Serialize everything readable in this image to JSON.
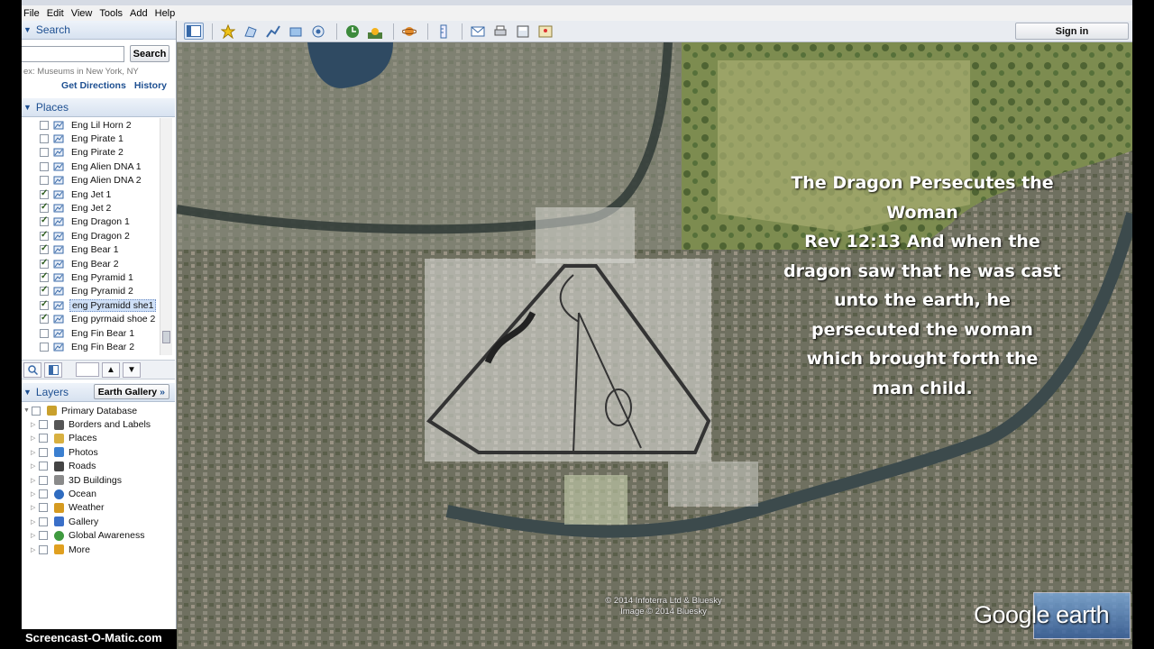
{
  "menu": [
    "File",
    "Edit",
    "View",
    "Tools",
    "Add",
    "Help"
  ],
  "toolbar": {
    "sign_in": "Sign in"
  },
  "search": {
    "title": "Search",
    "button": "Search",
    "hint": "ex: Museums in New York, NY",
    "get_directions": "Get Directions",
    "history": "History"
  },
  "places": {
    "title": "Places",
    "items": [
      {
        "label": "Eng Lil Horn 2",
        "checked": false
      },
      {
        "label": "Eng Pirate 1",
        "checked": false
      },
      {
        "label": "Eng Pirate 2",
        "checked": false
      },
      {
        "label": "Eng Alien DNA 1",
        "checked": false
      },
      {
        "label": "Eng Alien DNA 2",
        "checked": false
      },
      {
        "label": "Eng Jet 1",
        "checked": true
      },
      {
        "label": "Eng Jet 2",
        "checked": true
      },
      {
        "label": "Eng Dragon 1",
        "checked": true
      },
      {
        "label": "Eng Dragon 2",
        "checked": true
      },
      {
        "label": "Eng Bear 1",
        "checked": true
      },
      {
        "label": "Eng Bear 2",
        "checked": true
      },
      {
        "label": "Eng Pyramid 1",
        "checked": true
      },
      {
        "label": "Eng Pyramid 2",
        "checked": true
      },
      {
        "label": "eng Pyramidd she1",
        "checked": true,
        "selected": true
      },
      {
        "label": "Eng pyrmaid shoe 2",
        "checked": true
      },
      {
        "label": "Eng Fin Bear 1",
        "checked": false
      },
      {
        "label": "Eng Fin Bear 2",
        "checked": false
      }
    ]
  },
  "layers": {
    "title": "Layers",
    "earth_gallery": "Earth Gallery",
    "earth_gallery_arrow": "»",
    "items": [
      {
        "label": "Primary Database",
        "icon": "database-icon",
        "color": "#c9a02c"
      },
      {
        "label": "Borders and Labels",
        "icon": "flag-icon",
        "color": "#555555"
      },
      {
        "label": "Places",
        "icon": "places-icon",
        "color": "#d8b040"
      },
      {
        "label": "Photos",
        "icon": "photo-icon",
        "color": "#3b7fd0"
      },
      {
        "label": "Roads",
        "icon": "road-icon",
        "color": "#444444"
      },
      {
        "label": "3D Buildings",
        "icon": "building-icon",
        "color": "#8a8a8a"
      },
      {
        "label": "Ocean",
        "icon": "ocean-icon",
        "color": "#2f6cc0"
      },
      {
        "label": "Weather",
        "icon": "weather-icon",
        "color": "#d59a20"
      },
      {
        "label": "Gallery",
        "icon": "gallery-icon",
        "color": "#3a6fc8"
      },
      {
        "label": "Global Awareness",
        "icon": "globe-icon",
        "color": "#3f9a3f"
      },
      {
        "label": "More",
        "icon": "more-icon",
        "color": "#e0a020"
      }
    ]
  },
  "map": {
    "overlay_text": [
      "The Dragon Persecutes the",
      "Woman",
      "Rev 12:13 And when the",
      "dragon saw that he was cast",
      "unto the earth, he",
      "persecuted the woman",
      "which brought forth the",
      "man child."
    ],
    "copyright": [
      "© 2014 Infoterra Ltd & Bluesky",
      "Image © 2014 Bluesky"
    ],
    "logo": "Google earth"
  },
  "watermark": "Screencast-O-Matic.com",
  "colors": {
    "accent": "#1d4f91",
    "overlay_text": "#ffffff"
  }
}
